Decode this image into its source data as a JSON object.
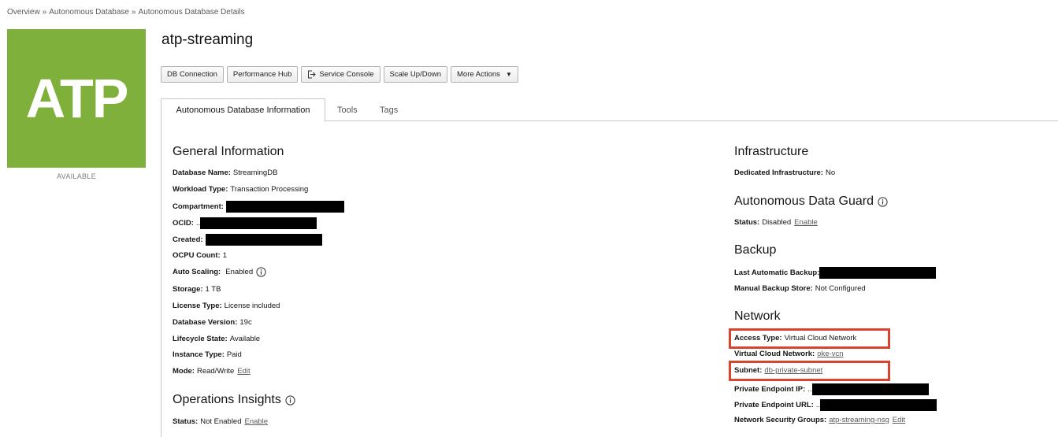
{
  "breadcrumb": [
    "Overview",
    "Autonomous Database",
    "Autonomous Database Details"
  ],
  "breadcrumb_sep": "»",
  "badge": {
    "text": "ATP",
    "status": "AVAILABLE",
    "color": "#7fb03c"
  },
  "title": "atp-streaming",
  "toolbar": {
    "db_connection": "DB Connection",
    "performance_hub": "Performance Hub",
    "service_console": "Service Console",
    "scale": "Scale Up/Down",
    "more_actions": "More Actions"
  },
  "tabs": [
    "Autonomous Database Information",
    "Tools",
    "Tags"
  ],
  "general": {
    "heading": "General Information",
    "database_name": {
      "label": "Database Name:",
      "value": "StreamingDB"
    },
    "workload_type": {
      "label": "Workload Type:",
      "value": "Transaction Processing"
    },
    "compartment": {
      "label": "Compartment:"
    },
    "ocid": {
      "label": "OCID:",
      "prefix": ".."
    },
    "created": {
      "label": "Created:"
    },
    "ocpu_count": {
      "label": "OCPU Count:",
      "value": "1"
    },
    "auto_scaling": {
      "label": "Auto Scaling:",
      "value": "Enabled"
    },
    "storage": {
      "label": "Storage:",
      "value": "1 TB"
    },
    "license_type": {
      "label": "License Type:",
      "value": "License included"
    },
    "database_version": {
      "label": "Database Version:",
      "value": "19c"
    },
    "lifecycle_state": {
      "label": "Lifecycle State:",
      "value": "Available"
    },
    "instance_type": {
      "label": "Instance Type:",
      "value": "Paid"
    },
    "mode": {
      "label": "Mode:",
      "value": "Read/Write",
      "action": "Edit"
    }
  },
  "ops_insights": {
    "heading": "Operations Insights",
    "status": {
      "label": "Status:",
      "value": "Not Enabled",
      "action": "Enable"
    }
  },
  "infrastructure": {
    "heading": "Infrastructure",
    "dedicated": {
      "label": "Dedicated Infrastructure:",
      "value": "No"
    }
  },
  "data_guard": {
    "heading": "Autonomous Data Guard",
    "status": {
      "label": "Status:",
      "value": "Disabled",
      "action": "Enable"
    }
  },
  "backup": {
    "heading": "Backup",
    "last_auto": {
      "label": "Last Automatic Backup:"
    },
    "manual_store": {
      "label": "Manual Backup Store:",
      "value": "Not Configured"
    }
  },
  "network": {
    "heading": "Network",
    "access_type": {
      "label": "Access Type:",
      "value": "Virtual Cloud Network"
    },
    "vcn": {
      "label": "Virtual Cloud Network:",
      "value": "oke-vcn"
    },
    "subnet": {
      "label": "Subnet:",
      "value": "db-private-subnet"
    },
    "private_ip": {
      "label": "Private Endpoint IP:",
      "prefix": ".."
    },
    "private_url": {
      "label": "Private Endpoint URL:",
      "prefix": ".."
    },
    "nsg": {
      "label": "Network Security Groups:",
      "value": "atp-streaming-nsg",
      "action": "Edit"
    }
  },
  "colors": {
    "highlight": "#d9442f",
    "link": "#5a5a5a"
  }
}
